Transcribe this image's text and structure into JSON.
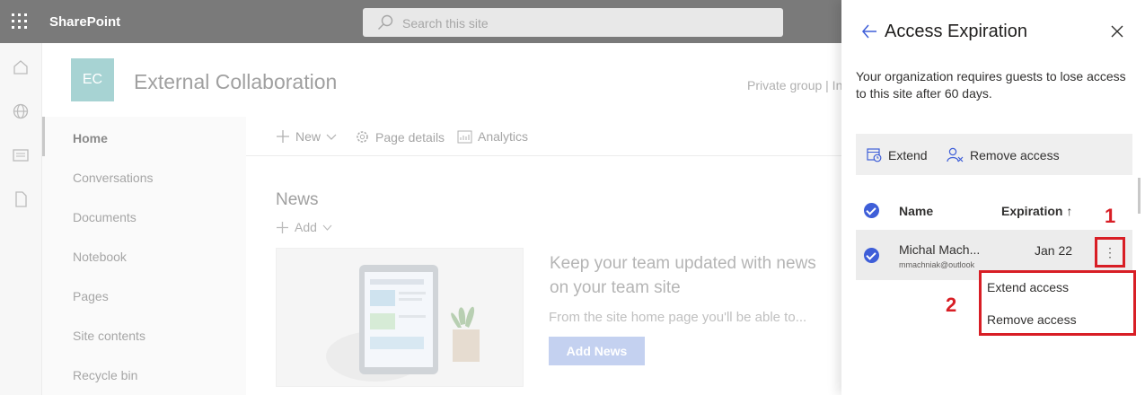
{
  "topbar": {
    "app_name": "SharePoint",
    "search_placeholder": "Search this site"
  },
  "site": {
    "logo_text": "EC",
    "title": "External Collaboration",
    "privacy": "Private group | In"
  },
  "nav": {
    "items": [
      "Home",
      "Conversations",
      "Documents",
      "Notebook",
      "Pages",
      "Site contents",
      "Recycle bin"
    ]
  },
  "commands": {
    "new": "New",
    "page_details": "Page details",
    "analytics": "Analytics"
  },
  "news": {
    "heading": "News",
    "add": "Add",
    "keep_title": "Keep your team updated with news on your team site",
    "from_text": "From the site home page you'll be able to...",
    "add_news": "Add News"
  },
  "panel": {
    "title": "Access Expiration",
    "description": "Your organization requires guests to lose access to this site after 60 days.",
    "toolbar": {
      "extend": "Extend",
      "remove": "Remove access"
    },
    "columns": {
      "name": "Name",
      "expiration": "Expiration",
      "sort_arrow": "↑"
    },
    "row": {
      "name": "Michal Mach...",
      "email": "mmachniak@outlook",
      "expiration": "Jan 22",
      "more": "⋮"
    },
    "menu": {
      "extend": "Extend access",
      "remove": "Remove access"
    },
    "callouts": {
      "one": "1",
      "two": "2"
    }
  },
  "colors": {
    "accent": "#3e5ed8",
    "callout": "#d81e25"
  }
}
